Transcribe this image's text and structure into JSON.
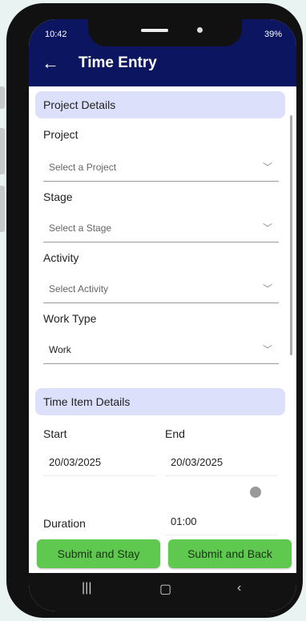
{
  "status": {
    "time": "10:42",
    "battery": "39%"
  },
  "appbar": {
    "back_icon": "arrow-left-icon",
    "title": "Time Entry"
  },
  "project_details": {
    "header": "Project Details",
    "project": {
      "label": "Project",
      "placeholder": "Select a Project"
    },
    "stage": {
      "label": "Stage",
      "placeholder": "Select a Stage"
    },
    "activity": {
      "label": "Activity",
      "placeholder": "Select Activity"
    },
    "work_type": {
      "label": "Work Type",
      "value": "Work"
    }
  },
  "time_item_details": {
    "header": "Time Item Details",
    "start": {
      "label": "Start",
      "value": "20/03/2025"
    },
    "end": {
      "label": "End",
      "value": "20/03/2025"
    },
    "duration": {
      "label": "Duration",
      "value": "01:00"
    }
  },
  "actions": {
    "submit_stay": "Submit and Stay",
    "submit_back": "Submit and Back"
  },
  "colors": {
    "appbar": "#0c1560",
    "section_header": "#dde0fb",
    "button": "#5fc94f"
  },
  "system_nav": {
    "icons": [
      "recents-icon",
      "home-icon",
      "back-icon"
    ]
  }
}
